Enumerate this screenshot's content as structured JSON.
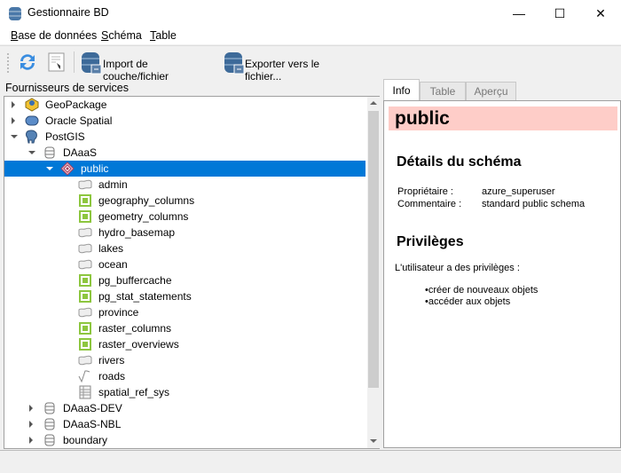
{
  "window": {
    "title": "Gestionnaire BD"
  },
  "menu": [
    {
      "accel": "B",
      "rest": "ase de données"
    },
    {
      "accel": "S",
      "rest": "chéma"
    },
    {
      "accel": "T",
      "rest": "able"
    }
  ],
  "toolbar": {
    "import_label": "Import de couche/fichier",
    "export_label": "Exporter vers le fichier..."
  },
  "providers": {
    "header": "Fournisseurs de services",
    "rows": [
      {
        "label": "GeoPackage",
        "icon": "geopackage-icon",
        "level": 0,
        "state": "collapsed"
      },
      {
        "label": "Oracle Spatial",
        "icon": "oracle-icon",
        "level": 0,
        "state": "collapsed"
      },
      {
        "label": "PostGIS",
        "icon": "postgis-elephant-icon",
        "level": 0,
        "state": "expanded"
      },
      {
        "label": "DAaaS",
        "icon": "database-icon",
        "level": 1,
        "state": "expanded"
      },
      {
        "label": "public",
        "icon": "schema-icon",
        "level": 2,
        "state": "expanded",
        "selected": true
      },
      {
        "label": "admin",
        "icon": "polygon-layer-icon",
        "level": 3
      },
      {
        "label": "geography_columns",
        "icon": "view-icon",
        "level": 3
      },
      {
        "label": "geometry_columns",
        "icon": "view-icon",
        "level": 3
      },
      {
        "label": "hydro_basemap",
        "icon": "polygon-layer-icon",
        "level": 3
      },
      {
        "label": "lakes",
        "icon": "polygon-layer-icon",
        "level": 3
      },
      {
        "label": "ocean",
        "icon": "polygon-layer-icon",
        "level": 3
      },
      {
        "label": "pg_buffercache",
        "icon": "view-icon",
        "level": 3
      },
      {
        "label": "pg_stat_statements",
        "icon": "view-icon",
        "level": 3
      },
      {
        "label": "province",
        "icon": "polygon-layer-icon",
        "level": 3
      },
      {
        "label": "raster_columns",
        "icon": "view-icon",
        "level": 3
      },
      {
        "label": "raster_overviews",
        "icon": "view-icon",
        "level": 3
      },
      {
        "label": "rivers",
        "icon": "polygon-layer-icon",
        "level": 3
      },
      {
        "label": "roads",
        "icon": "line-layer-icon",
        "level": 3
      },
      {
        "label": "spatial_ref_sys",
        "icon": "table-icon",
        "level": 3
      },
      {
        "label": "DAaaS-DEV",
        "icon": "database-icon",
        "level": 1,
        "state": "collapsed"
      },
      {
        "label": "DAaaS-NBL",
        "icon": "database-icon",
        "level": 1,
        "state": "collapsed"
      },
      {
        "label": "boundary",
        "icon": "database-icon",
        "level": 1,
        "state": "collapsed"
      }
    ]
  },
  "tabs": [
    {
      "label": "Info",
      "active": true
    },
    {
      "label": "Table"
    },
    {
      "label": "Aperçu"
    }
  ],
  "info": {
    "title": "public",
    "details_heading": "Détails du schéma",
    "owner_label": "Propriétaire :",
    "owner_value": "azure_superuser",
    "comment_label": "Commentaire :",
    "comment_value": "standard public schema",
    "privileges_heading": "Privilèges",
    "privileges_intro": "L'utilisateur a des privilèges :",
    "privileges": [
      "créer de nouveaux objets",
      "accéder aux objets"
    ]
  },
  "colors": {
    "selection": "#0078d7",
    "title_bg": "#fecdc8",
    "view_icon": "#8dc63f"
  }
}
